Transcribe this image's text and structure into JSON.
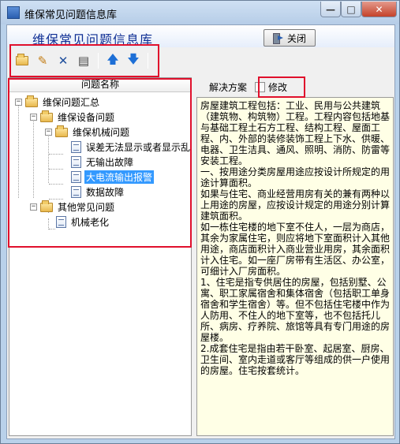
{
  "window": {
    "title": "维保常见问题信息库",
    "controls": {
      "minimize": "—",
      "maximize": "□",
      "close": "✕"
    }
  },
  "header": {
    "title": "维保常见问题信息库",
    "close_button": "关闭"
  },
  "toolbar": {
    "buttons": [
      {
        "name": "open-folder-icon"
      },
      {
        "name": "edit-icon",
        "glyph": "✎"
      },
      {
        "name": "delete-icon",
        "glyph": "✕"
      },
      {
        "name": "properties-icon",
        "glyph": "▤"
      },
      {
        "name": "move-up-icon",
        "glyph": "🡅"
      },
      {
        "name": "move-down-icon",
        "glyph": "🡇"
      }
    ]
  },
  "tree": {
    "header": "问题名称",
    "nodes": [
      {
        "label": "维保问题汇总",
        "expander": "−"
      },
      {
        "label": "维保设备问题",
        "expander": "−"
      },
      {
        "label": "维保机械问题",
        "expander": "−"
      },
      {
        "label": "误差无法显示或者显示乱"
      },
      {
        "label": "无输出故障"
      },
      {
        "label": "大电流输出报警"
      },
      {
        "label": "数据故障"
      },
      {
        "label": "其他常见问题",
        "expander": "−"
      },
      {
        "label": "机械老化"
      }
    ]
  },
  "right": {
    "tab_label": "解决方案",
    "edit_label": "修改",
    "content": [
      "房屋建筑工程包括：工业、民用与公共建筑（建筑物、构筑物）工程。工程内容包括地基与基础工程土石方工程、结构工程、屋面工程、内、外部的装修装饰工程上下水、供暖、电器、卫生洁具、通风、照明、消防、防雷等安装工程。",
      "一、按用途分类房屋用途应按设计所规定的用途计算面积。",
      "如果与住宅、商业经营用房有关的兼有两种以上用途的房屋，应按设计规定的用途分别计算建筑面积。",
      "如一栋住宅楼的地下室不住人，一层为商店，其余为家属住宅，则应将地下室面积计入其他用途，商店面积计入商业营业用房，其余面积计入住宅。如一座厂房带有生活区、办公室，可细计入厂房面积。",
      "1、住宅是指专供居住的房屋，包括别墅、公寓、职工家属宿舍和集体宿舍（包括职工单身宿舍和学生宿舍）等。但不包括住宅楼中作为人防用、不住人的地下室等，也不包括托儿所、病房、疗养院、旅馆等具有专门用途的房屋楼。",
      "2.成套住宅是指由若干卧室、起居室、厨房、卫生间、室内走道或客厅等组成的供一户使用的房屋。住宅按套统计。"
    ]
  }
}
